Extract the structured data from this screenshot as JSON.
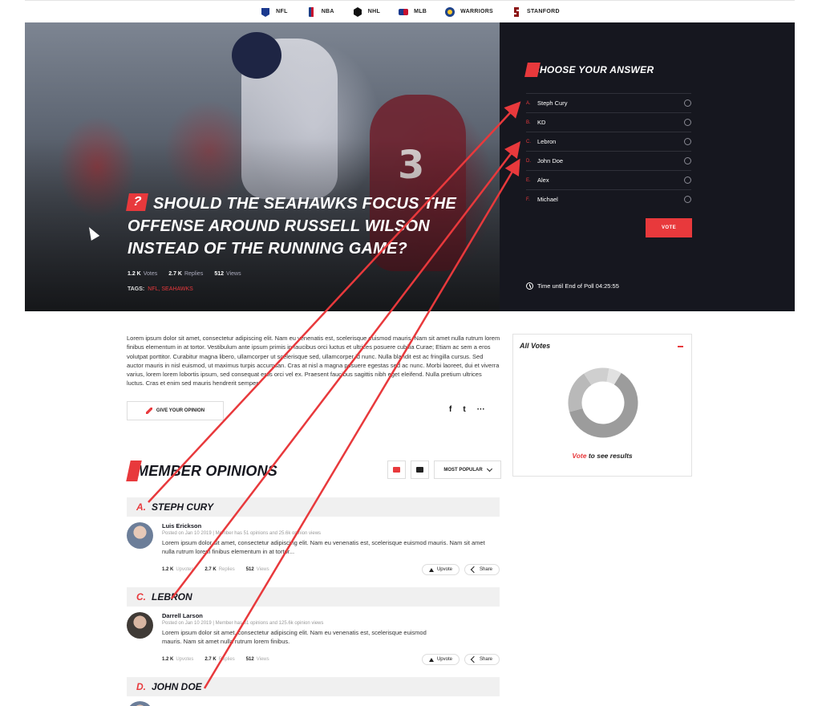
{
  "nav": {
    "leagues": [
      {
        "label": "NFL",
        "color": "#1b3a8f",
        "icon": "nfl-logo-icon"
      },
      {
        "label": "NBA",
        "color": "#1d428a",
        "icon": "nba-logo-icon"
      },
      {
        "label": "NHL",
        "color": "#111111",
        "icon": "nhl-logo-icon"
      },
      {
        "label": "MLB",
        "color": "#1b3a8f",
        "icon": "mlb-logo-icon"
      },
      {
        "label": "WARRIORS",
        "color": "#1d428a",
        "icon": "warriors-logo-icon"
      },
      {
        "label": "STANFORD",
        "color": "#8c1515",
        "icon": "stanford-logo-icon"
      }
    ]
  },
  "hero": {
    "badge": "?",
    "title": "Should the Seahawks focus the offense around Russell Wilson instead of the running game?",
    "stats": [
      {
        "value": "1.2 K",
        "label": "Votes"
      },
      {
        "value": "2.7 K",
        "label": "Replies"
      },
      {
        "value": "512",
        "label": "Views"
      }
    ],
    "tags_label": "TAGS:",
    "tags": "NFL, SEAHAWKS"
  },
  "poll": {
    "title": "CHOOSE YOUR ANSWER",
    "options": [
      {
        "letter": "A.",
        "label": "Steph Cury"
      },
      {
        "letter": "B.",
        "label": "KD"
      },
      {
        "letter": "C.",
        "label": "Lebron"
      },
      {
        "letter": "D.",
        "label": "John Doe"
      },
      {
        "letter": "E.",
        "label": "Alex"
      },
      {
        "letter": "F.",
        "label": "Michael"
      }
    ],
    "vote_label": "VOTE",
    "timer": "Time until End of Poll 04:25:55"
  },
  "article": {
    "body": "Lorem ipsum dolor sit amet, consectetur adipiscing elit. Nam eu venenatis est, scelerisque euismod mauris. Nam sit amet nulla rutrum lorem finibus elementum in at tortor. Vestibulum ante ipsum primis in faucibus orci luctus et ultrices posuere cubilia Curae; Etiam ac sem a eros volutpat porttitor. Curabitur magna libero, ullamcorper ut scelerisque sed, ullamcorper id nunc. Nulla blandit est ac fringilla cursus. Sed auctor mauris in nisl euismod, ut maximus turpis accumsan. Cras at nisl a magna posuere egestas sed ac nunc. Morbi laoreet, dui et viverra varius, lorem lorem lobortis ipsum, sed consequat eros orci vel ex. Praesent faucibus sagittis nibh eget eleifend. Nulla pretium ultrices luctus. Cras et enim sed mauris hendrerit semper.",
    "opinion_button": "GIVE YOUR OPINION",
    "share_icons": [
      "f",
      "t",
      "···"
    ]
  },
  "votes": {
    "title": "All Votes",
    "note_red": "Vote",
    "note_rest": " to see results",
    "colors": [
      "#9c9c9c",
      "#b9b9b9",
      "#cfcfcf",
      "#e1e1e1"
    ]
  },
  "opinions": {
    "title": "MEMBER OPINIONS",
    "sort": "MOST POPULAR",
    "groups": [
      {
        "letter": "A.",
        "name": "STEPH CURY"
      },
      {
        "letter": "C.",
        "name": "LEBRON"
      },
      {
        "letter": "D.",
        "name": "JOHN DOE"
      }
    ],
    "items": [
      {
        "name": "Luis Erickson",
        "meta": "Posted on Jan 10 2019 | Member has 51 opinions and 25.6k opinion views",
        "text": "Lorem ipsum dolor sit amet, consectetur adipiscing elit. Nam eu venenatis est, scelerisque euismod mauris. Nam sit amet nulla rutrum lorem finibus elementum in at tortor...",
        "stats": [
          {
            "value": "1.2 K",
            "label": "Upvotes"
          },
          {
            "value": "2.7 K",
            "label": "Replies"
          },
          {
            "value": "512",
            "label": "Views"
          }
        ],
        "upvote": "Upvote",
        "share": "Share"
      },
      {
        "name": "Darrell Larson",
        "meta": "Posted on Jan 10 2019 | Member has 51 opinions and 125.6k opinion views",
        "text": "Lorem ipsum dolor sit amet, consectetur adipiscing elit. Nam eu venenatis est, scelerisque euismod mauris. Nam sit amet nulla rutrum lorem finibus.",
        "stats": [
          {
            "value": "1.2 K",
            "label": "Upvotes"
          },
          {
            "value": "2.7 K",
            "label": "Replies"
          },
          {
            "value": "512",
            "label": "Views"
          }
        ],
        "upvote": "Upvote",
        "share": "Share"
      }
    ]
  },
  "annotation_color": "#e8393c"
}
